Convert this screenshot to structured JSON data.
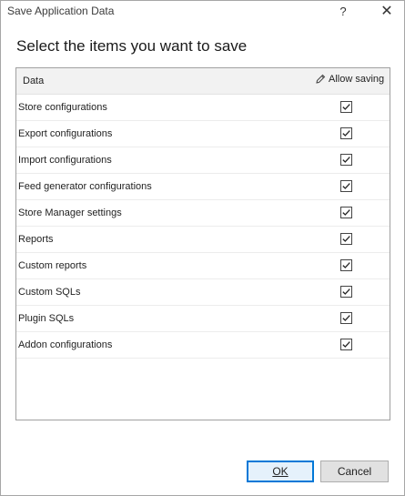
{
  "window": {
    "title": "Save Application Data",
    "help_label": "?",
    "close_label": "✕"
  },
  "heading": "Select the items you want to save",
  "grid": {
    "columns": {
      "data": "Data",
      "allow_saving": "Allow saving"
    },
    "rows": [
      {
        "label": "Store configurations",
        "checked": true
      },
      {
        "label": "Export configurations",
        "checked": true
      },
      {
        "label": "Import configurations",
        "checked": true
      },
      {
        "label": "Feed generator configurations",
        "checked": true
      },
      {
        "label": "Store Manager settings",
        "checked": true
      },
      {
        "label": "Reports",
        "checked": true
      },
      {
        "label": "Custom reports",
        "checked": true
      },
      {
        "label": "Custom SQLs",
        "checked": true
      },
      {
        "label": "Plugin SQLs",
        "checked": true
      },
      {
        "label": "Addon configurations",
        "checked": true
      }
    ]
  },
  "buttons": {
    "ok": "OK",
    "cancel": "Cancel"
  },
  "icons": {
    "header_edit": "pencil-icon",
    "checked": "checkmark-icon"
  },
  "colors": {
    "ok_border": "#0078d7",
    "header_bg": "#f2f2f2"
  }
}
